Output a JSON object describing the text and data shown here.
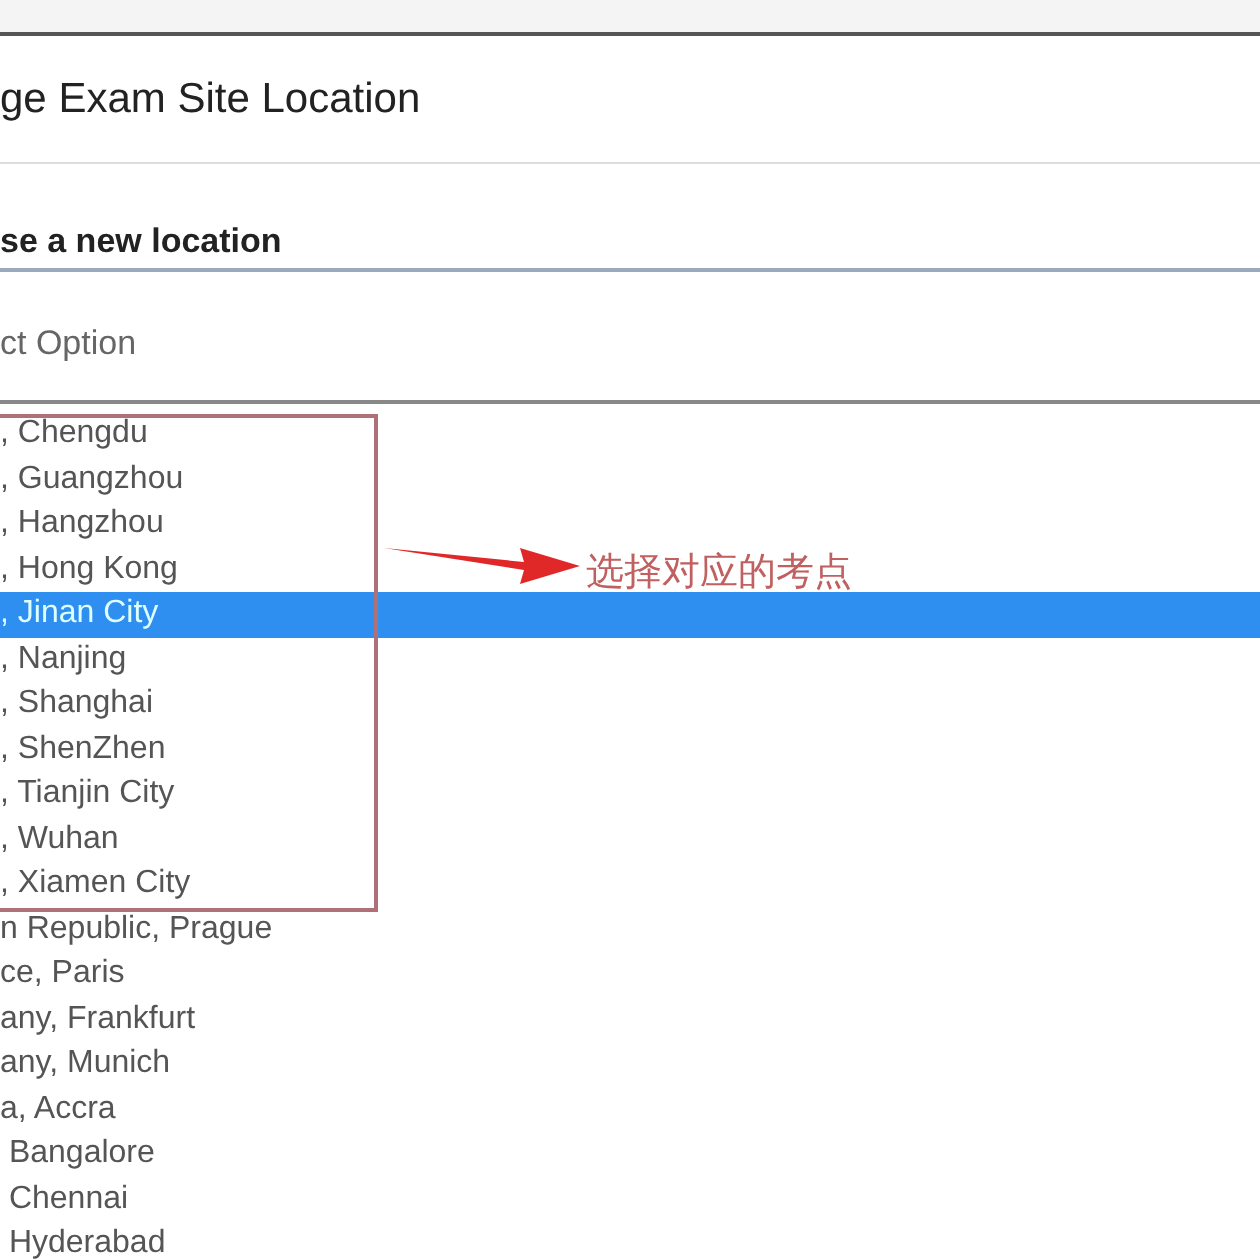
{
  "dialog": {
    "title": "ge Exam Site Location"
  },
  "section_label": "se a new location",
  "select": {
    "placeholder": "ct Option"
  },
  "options": [
    {
      "label": ", Chengdu",
      "selected": false
    },
    {
      "label": ", Guangzhou",
      "selected": false
    },
    {
      "label": ", Hangzhou",
      "selected": false
    },
    {
      "label": ", Hong Kong",
      "selected": false
    },
    {
      "label": ", Jinan City",
      "selected": true
    },
    {
      "label": ", Nanjing",
      "selected": false
    },
    {
      "label": ", Shanghai",
      "selected": false
    },
    {
      "label": ", ShenZhen",
      "selected": false
    },
    {
      "label": ", Tianjin City",
      "selected": false
    },
    {
      "label": ", Wuhan",
      "selected": false
    },
    {
      "label": ", Xiamen City",
      "selected": false
    },
    {
      "label": "n Republic, Prague",
      "selected": false
    },
    {
      "label": "ce, Paris",
      "selected": false
    },
    {
      "label": "any, Frankfurt",
      "selected": false
    },
    {
      "label": "any, Munich",
      "selected": false
    },
    {
      "label": "a, Accra",
      "selected": false
    },
    {
      "label": " Bangalore",
      "selected": false
    },
    {
      "label": " Chennai",
      "selected": false
    },
    {
      "label": " Hyderabad",
      "selected": false
    }
  ],
  "annotation": {
    "text": "选择对应的考点"
  }
}
